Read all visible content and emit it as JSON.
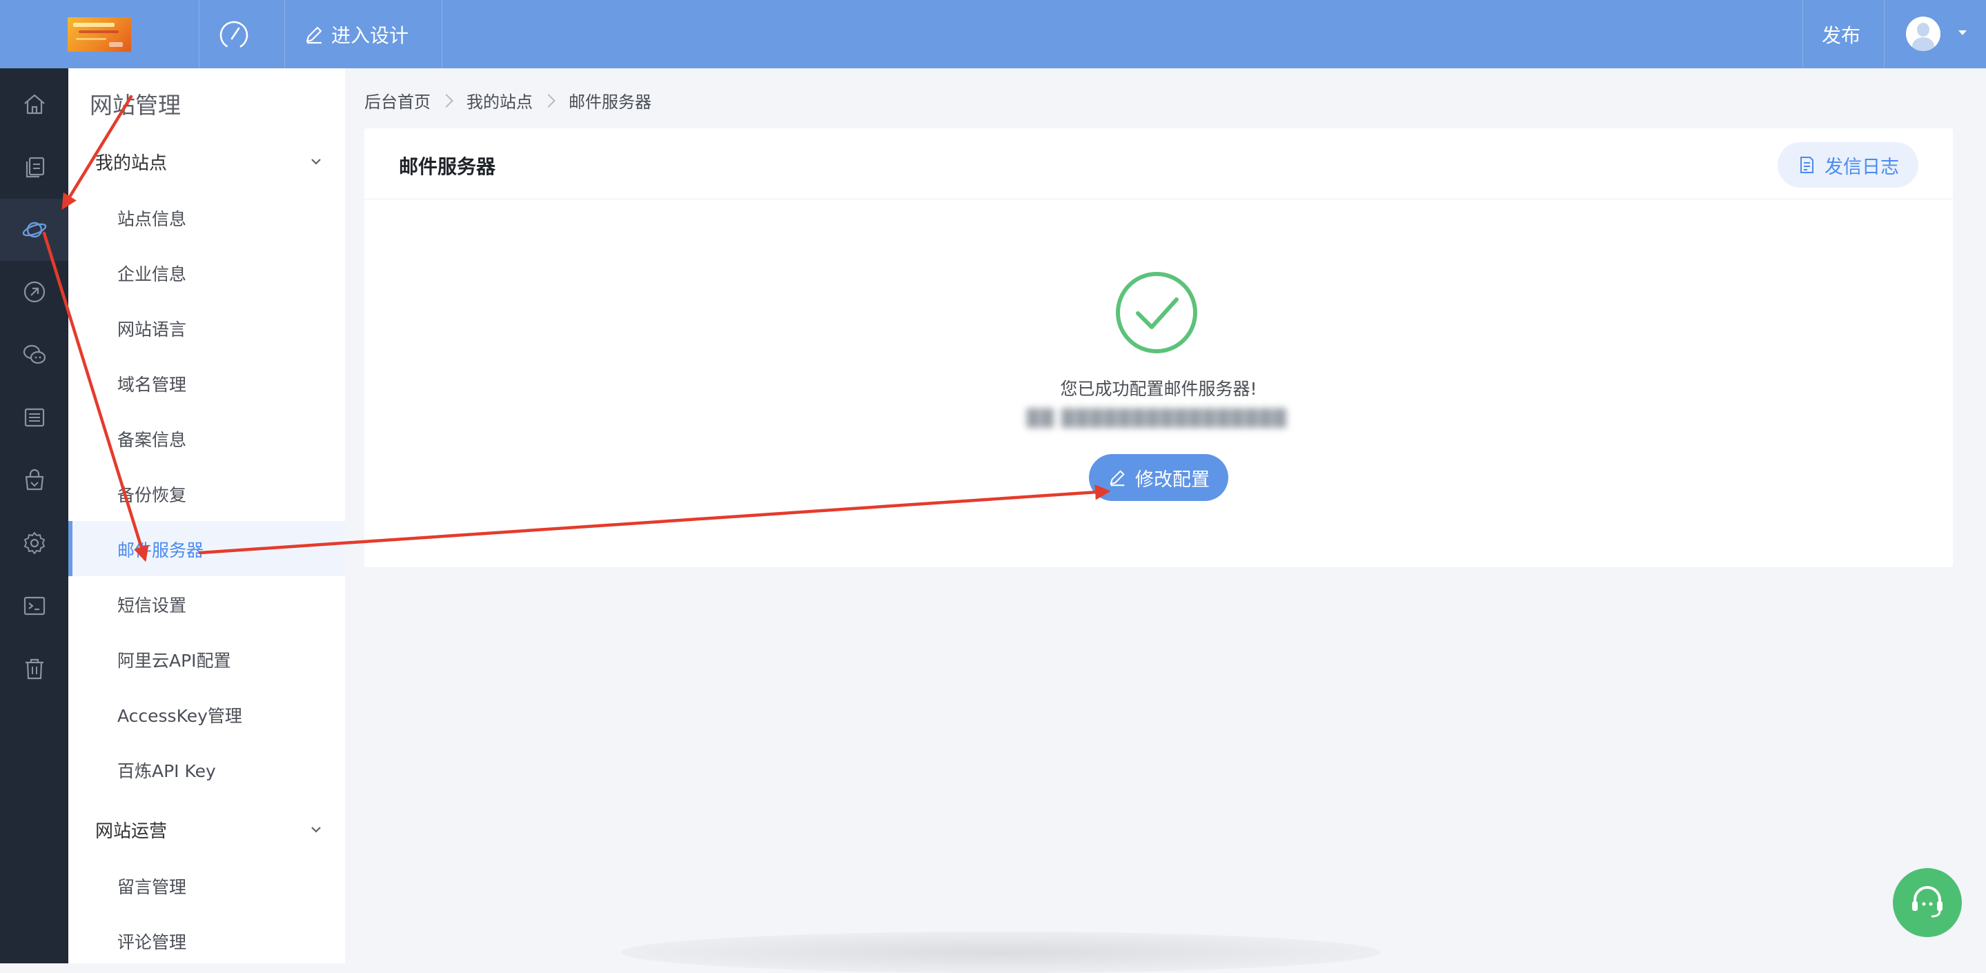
{
  "topbar": {
    "design_label": "进入设计",
    "publish_label": "发布"
  },
  "rail": {
    "items": [
      "home-icon",
      "pages-icon",
      "planet-icon",
      "link-icon",
      "wechat-icon",
      "list-icon",
      "store-icon",
      "gear-icon",
      "terminal-icon",
      "trash-icon"
    ],
    "active": "planet-icon"
  },
  "menu": {
    "title": "网站管理",
    "groups": [
      {
        "label": "我的站点",
        "items": [
          "站点信息",
          "企业信息",
          "网站语言",
          "域名管理",
          "备案信息",
          "备份恢复",
          "邮件服务器",
          "短信设置",
          "阿里云API配置",
          "AccessKey管理",
          "百炼API Key"
        ]
      },
      {
        "label": "网站运营",
        "items": [
          "留言管理",
          "评论管理"
        ]
      }
    ],
    "active_item": "邮件服务器"
  },
  "breadcrumb": [
    "后台首页",
    "我的站点",
    "邮件服务器"
  ],
  "card": {
    "title": "邮件服务器",
    "log_button": "发信日志",
    "success_message": "您已成功配置邮件服务器!",
    "email_blurred": "██ ████████████████",
    "edit_button": "修改配置"
  },
  "colors": {
    "topbar": "#6b9be2",
    "rail": "#212936",
    "accent": "#4a8af0",
    "success": "#5cc27a",
    "annotation": "#e53b2c"
  }
}
